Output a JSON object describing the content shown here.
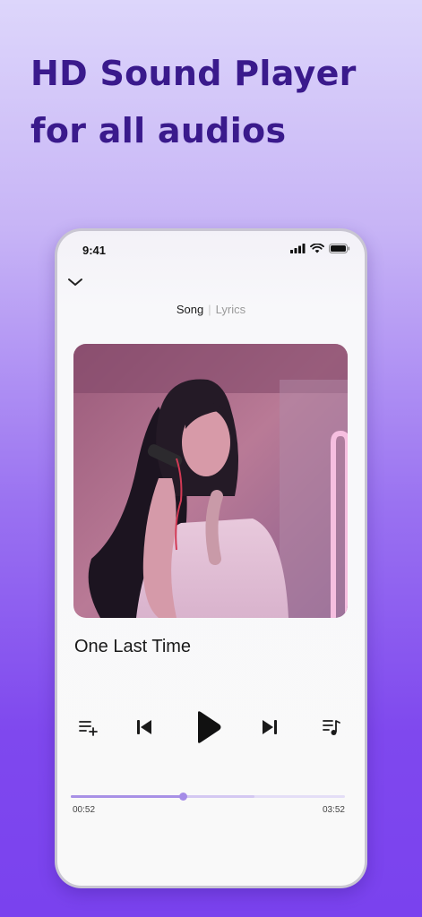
{
  "headline": {
    "line1": "HD Sound Player",
    "line2": "for all audios"
  },
  "status_bar": {
    "time": "9:41"
  },
  "header": {
    "tabs": [
      {
        "label": "Song"
      },
      {
        "label": "Lyrics"
      }
    ],
    "separator": "|"
  },
  "player": {
    "title": "One Last Time",
    "elapsed": "00:52",
    "duration": "03:52",
    "progress_fraction": 0.41,
    "buffered_fraction": 0.67
  },
  "icons": {
    "collapse": "chevron-down-icon",
    "add_to_queue": "playlist-add-icon",
    "previous": "skip-previous-icon",
    "play": "play-icon",
    "next": "skip-next-icon",
    "queue": "queue-music-icon"
  },
  "colors": {
    "headline": "#3a1a8c",
    "accent": "#a891e6",
    "background_bottom": "#7a42ee"
  }
}
